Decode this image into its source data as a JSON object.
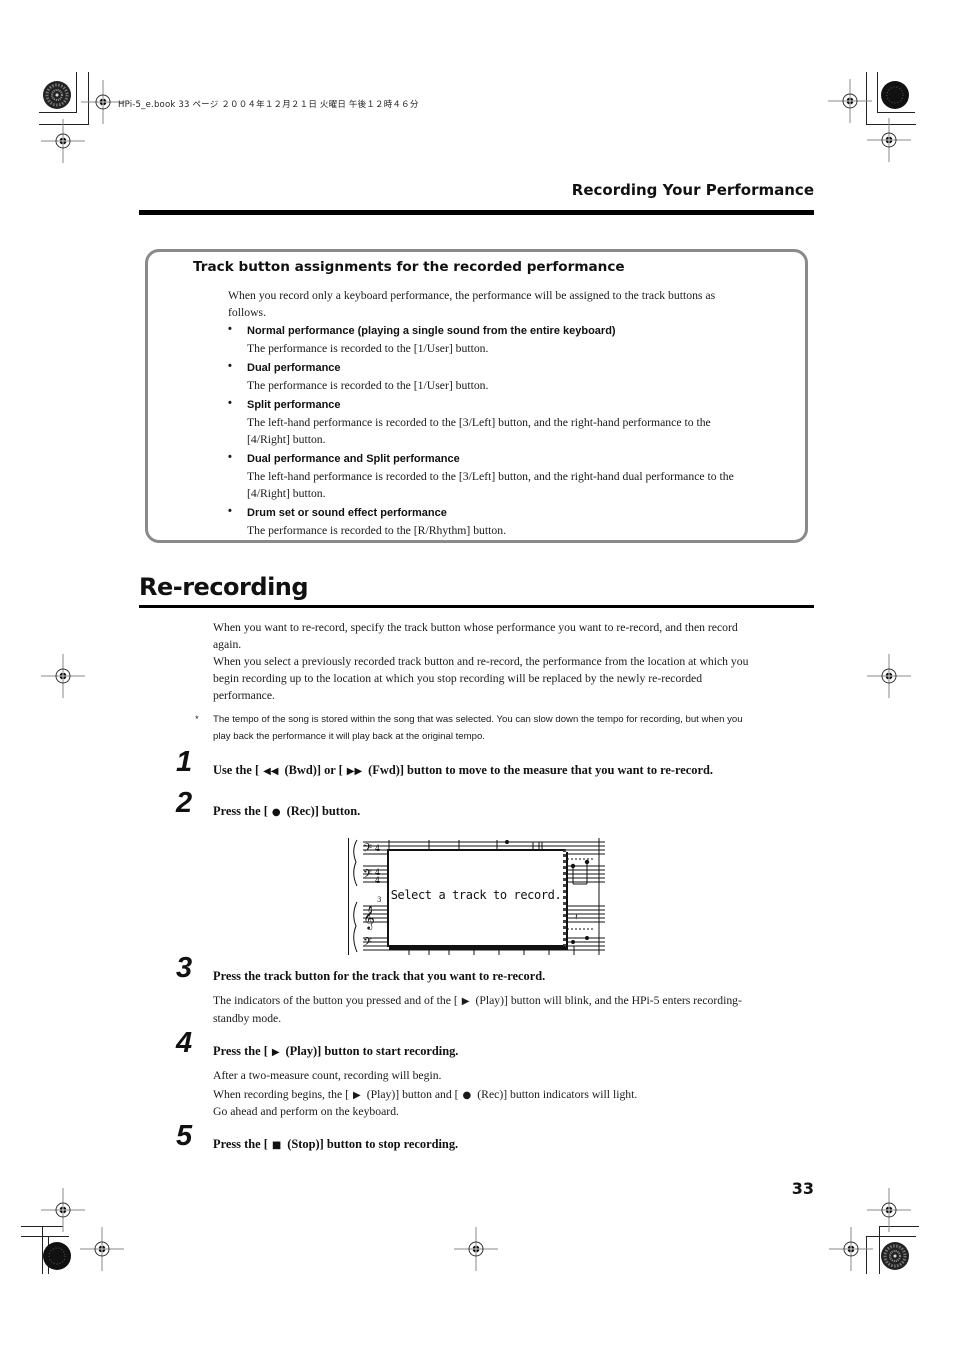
{
  "slug": "HPi-5_e.book  33 ページ  ２００４年１２月２１日  火曜日  午後１２時４６分",
  "running_head": "Recording Your Performance",
  "note": {
    "title": "Track button assignments for the recorded performance",
    "intro": "When you record only a keyboard performance, the performance will be assigned to the track buttons as follows.",
    "items": [
      {
        "title": "Normal performance (playing a single sound from the entire keyboard)",
        "body": "The performance is recorded to the [1/User] button."
      },
      {
        "title": "Dual performance",
        "body": "The performance is recorded to the [1/User] button."
      },
      {
        "title": "Split performance",
        "body": "The left-hand performance is recorded to the [3/Left] button, and the right-hand performance to the [4/Right] button."
      },
      {
        "title": "Dual performance and Split performance",
        "body": "The left-hand performance is recorded to the [3/Left] button, and the right-hand dual performance to the [4/Right] button."
      },
      {
        "title": "Drum set or sound effect performance",
        "body": "The performance is recorded to the [R/Rhythm] button."
      }
    ]
  },
  "section": {
    "title": "Re-recording",
    "para1": "When you want to re-record, specify the track button whose performance you want to re-record, and then record again.",
    "para2": "When you select a previously recorded track button and re-record, the performance from the location at which you begin recording up to the location at which you stop recording will be replaced by the newly re-recorded performance.",
    "footnote_mark": "*",
    "footnote": "The tempo of the song is stored within the song that was selected. You can slow down the tempo for recording, but when you play back the performance it will play back at the original tempo."
  },
  "steps": [
    {
      "num": "1",
      "parts": [
        "Use the [",
        "(Bwd)] or [",
        "(Fwd)] button to move to the measure that you want to re-record."
      ]
    },
    {
      "num": "2",
      "parts": [
        "Press the [",
        "(Rec)] button."
      ]
    },
    {
      "num": "3",
      "text": "Press the track button for the track that you want to re-record.",
      "body_parts": [
        "The indicators of the button you pressed and of the [",
        "(Play)] button will blink, and the HPi-5 enters recording-standby mode."
      ]
    },
    {
      "num": "4",
      "parts": [
        "Press the [",
        "(Play)] button to start recording."
      ],
      "body1": "After a two-measure count, recording will begin.",
      "body2_parts": [
        "When recording begins, the [",
        "(Play)] button and [",
        "(Rec)] button indicators will light."
      ],
      "body3": "Go ahead and perform on the keyboard."
    },
    {
      "num": "5",
      "parts": [
        "Press the [",
        "(Stop)] button to stop recording."
      ]
    }
  ],
  "icons": {
    "bwd": "◀◀",
    "fwd": "▶▶",
    "rec": "●",
    "play": "▶",
    "stop": "■"
  },
  "lcd": {
    "message": "Select a track to record."
  },
  "page_number": "33"
}
